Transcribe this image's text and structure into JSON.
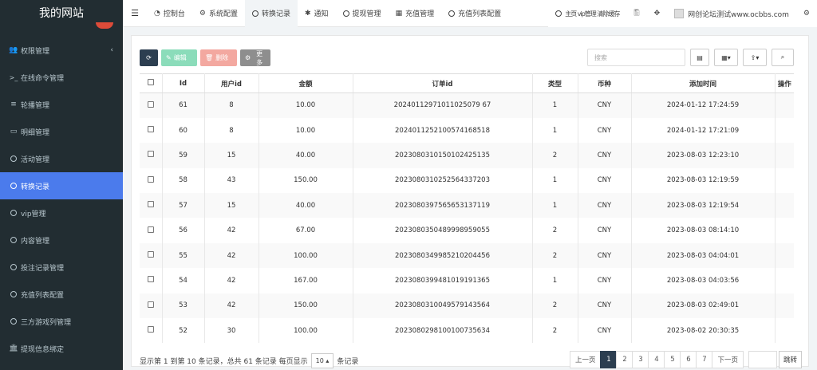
{
  "brand": "我的网站",
  "sidebar": {
    "items": [
      {
        "label": "权限管理",
        "icon": "users-icon"
      },
      {
        "label": "在线命令管理",
        "icon": "terminal-icon"
      },
      {
        "label": "轮播管理",
        "icon": "list-icon"
      },
      {
        "label": "明细管理",
        "icon": "calendar-icon"
      },
      {
        "label": "活动管理",
        "icon": "circle-icon"
      },
      {
        "label": "转换记录",
        "icon": "circle-icon",
        "active": true
      },
      {
        "label": "vip管理",
        "icon": "circle-icon"
      },
      {
        "label": "内容管理",
        "icon": "circle-icon"
      },
      {
        "label": "投注记录管理",
        "icon": "circle-icon"
      },
      {
        "label": "充值列表配置",
        "icon": "circle-icon"
      },
      {
        "label": "三方游戏列管理",
        "icon": "circle-icon"
      },
      {
        "label": "提现信息绑定",
        "icon": "bank-icon"
      }
    ]
  },
  "topnav": {
    "tabs": [
      {
        "label": "控制台",
        "icon": "dashboard-icon"
      },
      {
        "label": "系统配置",
        "icon": "cog-icon"
      },
      {
        "label": "转换记录",
        "icon": "circle-icon",
        "active": true
      },
      {
        "label": "通知",
        "icon": "asterisk-icon"
      },
      {
        "label": "提现管理",
        "icon": "circle-icon"
      },
      {
        "label": "充值管理",
        "icon": "grid-icon"
      },
      {
        "label": "充值列表配置",
        "icon": "circle-icon"
      }
    ],
    "overlap_text": "主页 vip管理 清除缓存",
    "site_name": "网创论坛测试www.ocbbs.com"
  },
  "toolbar": {
    "edit": "编辑",
    "delete": "删除",
    "more": "更多",
    "search_placeholder": "搜索"
  },
  "table": {
    "headers": [
      "Id",
      "用户id",
      "金额",
      "订单id",
      "类型",
      "币种",
      "添加时间",
      "操作"
    ],
    "rows": [
      [
        "61",
        "8",
        "10.00",
        "20240112971011025079 67",
        "1",
        "CNY",
        "2024-01-12 17:24:59"
      ],
      [
        "60",
        "8",
        "10.00",
        "2024011252100574168518",
        "1",
        "CNY",
        "2024-01-12 17:21:09"
      ],
      [
        "59",
        "15",
        "40.00",
        "2023080310150102425135",
        "2",
        "CNY",
        "2023-08-03 12:23:10"
      ],
      [
        "58",
        "43",
        "150.00",
        "2023080310252564337203",
        "1",
        "CNY",
        "2023-08-03 12:19:59"
      ],
      [
        "57",
        "15",
        "40.00",
        "2023080397565653137119",
        "1",
        "CNY",
        "2023-08-03 12:19:54"
      ],
      [
        "56",
        "42",
        "67.00",
        "2023080350489998959055",
        "2",
        "CNY",
        "2023-08-03 08:14:10"
      ],
      [
        "55",
        "42",
        "100.00",
        "2023080349985210204456",
        "2",
        "CNY",
        "2023-08-03 04:04:01"
      ],
      [
        "54",
        "42",
        "167.00",
        "2023080399481019191365",
        "1",
        "CNY",
        "2023-08-03 04:03:56"
      ],
      [
        "53",
        "42",
        "150.00",
        "2023080310049579143564",
        "2",
        "CNY",
        "2023-08-03 02:49:01"
      ],
      [
        "52",
        "30",
        "100.00",
        "2023080298100100735634",
        "2",
        "CNY",
        "2023-08-02 20:30:35"
      ]
    ]
  },
  "footer": {
    "info_prefix": "显示第 1 到第 10 条记录，总共 61 条记录 每页显示",
    "page_size": "10 ▴",
    "info_suffix": "条记录",
    "prev": "上一页",
    "next": "下一页",
    "pages": [
      "1",
      "2",
      "3",
      "4",
      "5",
      "6",
      "7"
    ],
    "current_page": "1",
    "jump": "跳转"
  }
}
